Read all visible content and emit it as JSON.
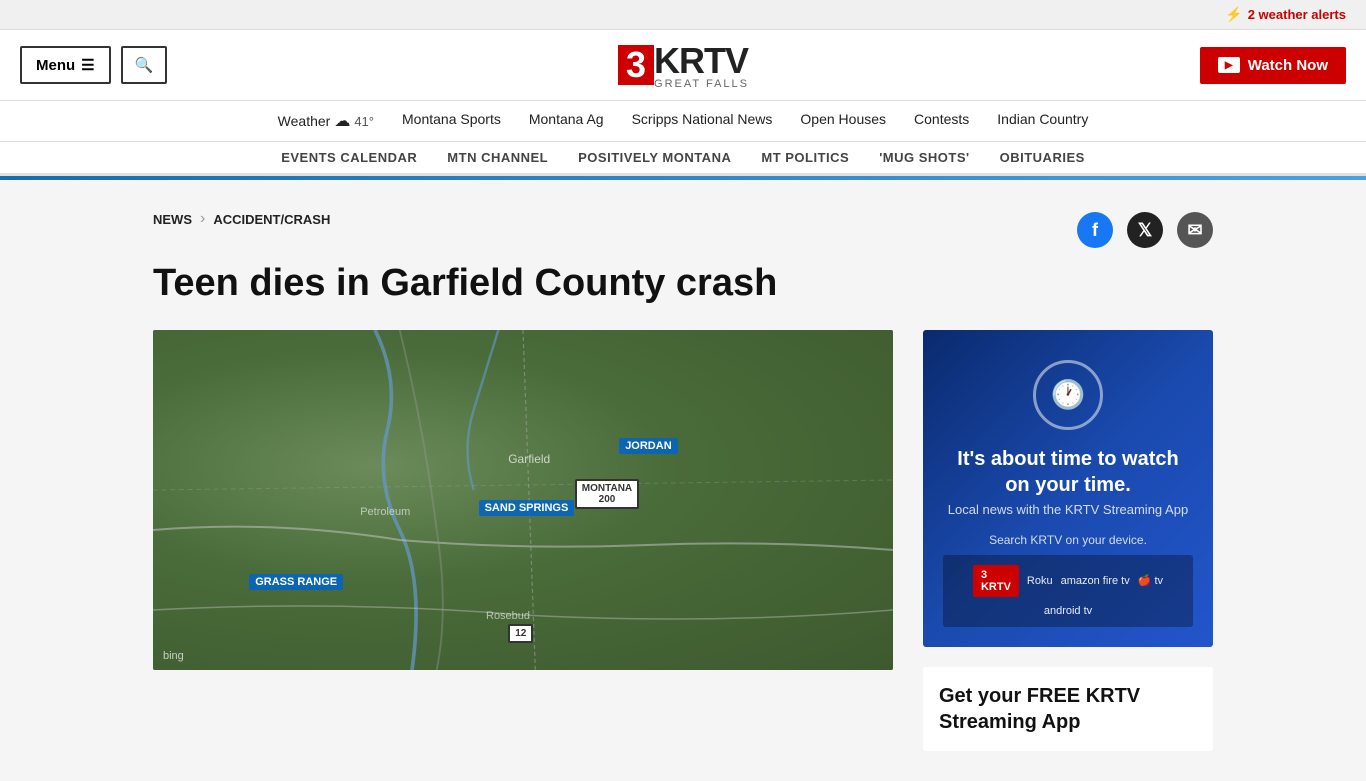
{
  "alert_bar": {
    "icon": "⚡",
    "text": "2 weather alerts"
  },
  "header": {
    "menu_label": "Menu",
    "logo_number": "3",
    "logo_name": "KRTV",
    "logo_sub": "GREAT FALLS",
    "watch_label": "Watch Now"
  },
  "primary_nav": {
    "items": [
      {
        "label": "Weather",
        "id": "weather",
        "has_icon": true,
        "temp": "41°"
      },
      {
        "label": "Montana Sports",
        "id": "montana-sports"
      },
      {
        "label": "Montana Ag",
        "id": "montana-ag"
      },
      {
        "label": "Scripps National News",
        "id": "scripps"
      },
      {
        "label": "Open Houses",
        "id": "open-houses"
      },
      {
        "label": "Contests",
        "id": "contests"
      },
      {
        "label": "Indian Country",
        "id": "indian-country"
      }
    ]
  },
  "secondary_nav": {
    "items": [
      {
        "label": "EVENTS CALENDAR",
        "id": "events-calendar"
      },
      {
        "label": "MTN CHANNEL",
        "id": "mtn-channel"
      },
      {
        "label": "POSITIVELY MONTANA",
        "id": "positively-montana"
      },
      {
        "label": "MT POLITICS",
        "id": "mt-politics"
      },
      {
        "label": "'MUG SHOTS'",
        "id": "mug-shots"
      },
      {
        "label": "OBITUARIES",
        "id": "obituaries"
      }
    ]
  },
  "breadcrumb": {
    "news_label": "NEWS",
    "separator": "›",
    "current_label": "ACCIDENT/CRASH"
  },
  "social": {
    "facebook_label": "f",
    "twitter_label": "𝕏",
    "email_label": "✉"
  },
  "article": {
    "title": "Teen dies in Garfield County crash"
  },
  "map": {
    "labels": {
      "jordan": "JORDAN",
      "sand_springs": "SAND SPRINGS",
      "grass_range": "GRASS RANGE",
      "garfield": "Garfield",
      "petroleum": "Petroleum",
      "rosebud": "Rosebud",
      "route_200": "MONTANA\n200",
      "route_12": "12",
      "bing": "bing"
    }
  },
  "sidebar_ad": {
    "clock_icon": "🕐",
    "title": "It's about time to watch on your time.",
    "subtitle": "Local news with the KRTV Streaming App",
    "search_text": "Search KRTV on your device.",
    "krtv_badge": "3\nKRTV",
    "platforms": [
      "Roku",
      "amazon fire tv",
      "🍎 tv",
      "android tv"
    ],
    "cta_title": "Get your FREE KRTV Streaming App"
  }
}
